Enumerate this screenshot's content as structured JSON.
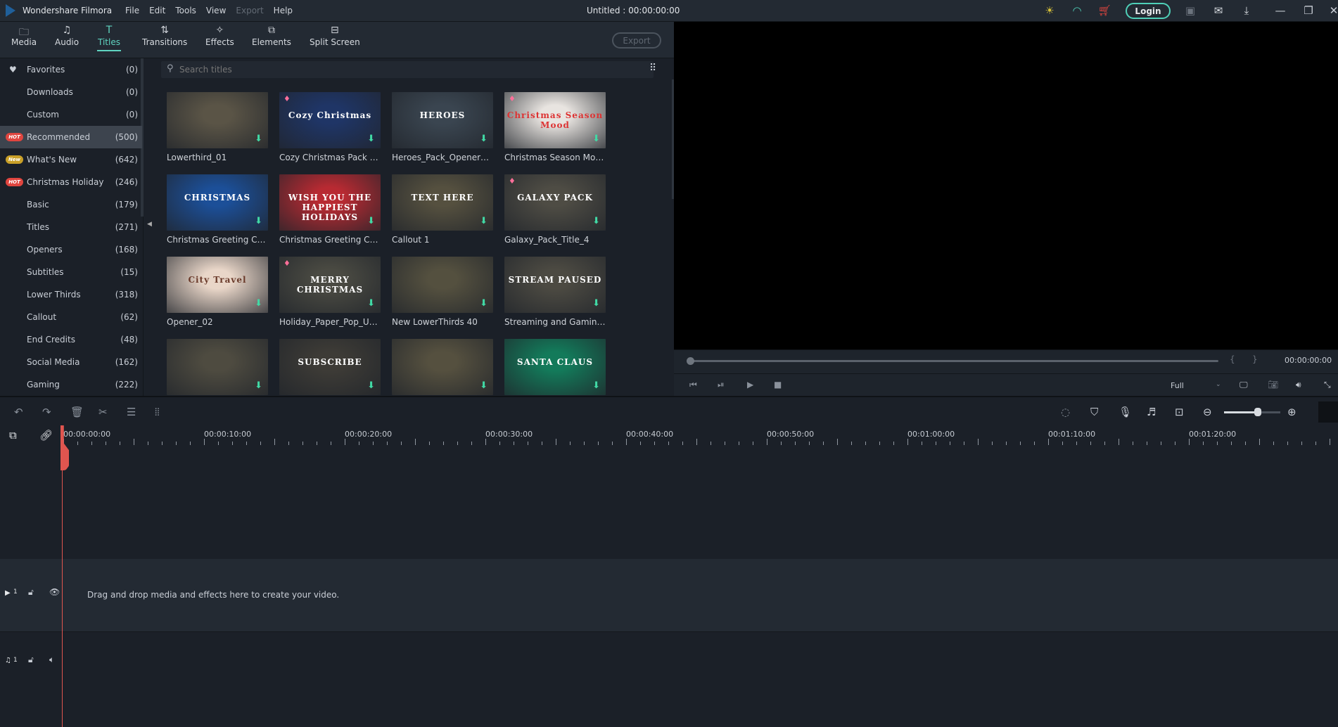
{
  "app": {
    "name": "Wondershare Filmora",
    "title": "Untitled : 00:00:00:00",
    "menu": [
      "File",
      "Edit",
      "Tools",
      "View",
      "Export",
      "Help"
    ],
    "menu_disabled": [
      "Export"
    ],
    "login": "Login"
  },
  "tabs": [
    {
      "label": "Media",
      "icon": "folder-icon"
    },
    {
      "label": "Audio",
      "icon": "music-icon"
    },
    {
      "label": "Titles",
      "icon": "text-icon",
      "active": true
    },
    {
      "label": "Transitions",
      "icon": "transition-icon"
    },
    {
      "label": "Effects",
      "icon": "effects-icon"
    },
    {
      "label": "Elements",
      "icon": "elements-icon"
    },
    {
      "label": "Split Screen",
      "icon": "split-screen-icon"
    }
  ],
  "export_label": "Export",
  "sidebar": [
    {
      "label": "Favorites",
      "count": "(0)",
      "icon": "heart"
    },
    {
      "label": "Downloads",
      "count": "(0)"
    },
    {
      "label": "Custom",
      "count": "(0)"
    },
    {
      "label": "Recommended",
      "count": "(500)",
      "badge": "HOT",
      "selected": true
    },
    {
      "label": "What's New",
      "count": "(642)",
      "badge": "New"
    },
    {
      "label": "Christmas Holiday",
      "count": "(246)",
      "badge": "HOT"
    },
    {
      "label": "Basic",
      "count": "(179)"
    },
    {
      "label": "Titles",
      "count": "(271)"
    },
    {
      "label": "Openers",
      "count": "(168)"
    },
    {
      "label": "Subtitles",
      "count": "(15)"
    },
    {
      "label": "Lower Thirds",
      "count": "(318)"
    },
    {
      "label": "Callout",
      "count": "(62)"
    },
    {
      "label": "End Credits",
      "count": "(48)"
    },
    {
      "label": "Social Media",
      "count": "(162)"
    },
    {
      "label": "Gaming",
      "count": "(222)"
    }
  ],
  "search": {
    "placeholder": "Search titles"
  },
  "titles": [
    {
      "name": "Lowerthird_01",
      "bg": "#5a5446",
      "art": ""
    },
    {
      "name": "Cozy Christmas Pack Op...",
      "bg": "#1f3566",
      "art": "Cozy Christmas",
      "premium": true
    },
    {
      "name": "Heroes_Pack_Openers_06",
      "bg": "#3a4550",
      "art": "HEROES"
    },
    {
      "name": "Christmas Season Mood ...",
      "bg": "#e8e4e0",
      "art": "Christmas Season Mood",
      "premium": true,
      "artColor": "#d33"
    },
    {
      "name": "Christmas Greeting Card...",
      "bg": "#1c4f98",
      "art": "CHRISTMAS"
    },
    {
      "name": "Christmas Greeting Card...",
      "bg": "#b82a32",
      "art": "WISH YOU THE HAPPIEST HOLIDAYS"
    },
    {
      "name": "Callout 1",
      "bg": "#55503f",
      "art": "TEXT HERE"
    },
    {
      "name": "Galaxy_Pack_Title_4",
      "bg": "#4e4c44",
      "art": "GALAXY PACK",
      "premium": true
    },
    {
      "name": "Opener_02",
      "bg": "#e9d6c8",
      "art": "City Travel",
      "artColor": "#6a3a2a"
    },
    {
      "name": "Holiday_Paper_Pop_Up_...",
      "bg": "#4a4a42",
      "art": "MERRY CHRISTMAS",
      "premium": true
    },
    {
      "name": "New LowerThirds 40",
      "bg": "#54503f",
      "art": ""
    },
    {
      "name": "Streaming and Gaming ...",
      "bg": "#4c4a42",
      "art": "STREAM PAUSED"
    },
    {
      "name": "",
      "bg": "#4e4b40",
      "art": ""
    },
    {
      "name": "",
      "bg": "#3d3b36",
      "art": "SUBSCRIBE"
    },
    {
      "name": "",
      "bg": "#55503f",
      "art": ""
    },
    {
      "name": "",
      "bg": "#137a5a",
      "art": "SANTA CLAUS"
    }
  ],
  "preview": {
    "timecode": "00:00:00:00",
    "quality": "Full"
  },
  "timeline": {
    "ruler": [
      "00:00:00:00",
      "00:00:10:00",
      "00:00:20:00",
      "00:00:30:00",
      "00:00:40:00",
      "00:00:50:00",
      "00:01:00:00",
      "00:01:10:00",
      "00:01:20:00"
    ],
    "video_track": "1",
    "audio_track": "1",
    "hint": "Drag and drop media and effects here to create your video.",
    "zoom_level": 0.6
  },
  "colors": {
    "accent": "#5fd4c0",
    "hot": "#e0453f",
    "new": "#c9a028",
    "playhead": "#e0554f"
  }
}
